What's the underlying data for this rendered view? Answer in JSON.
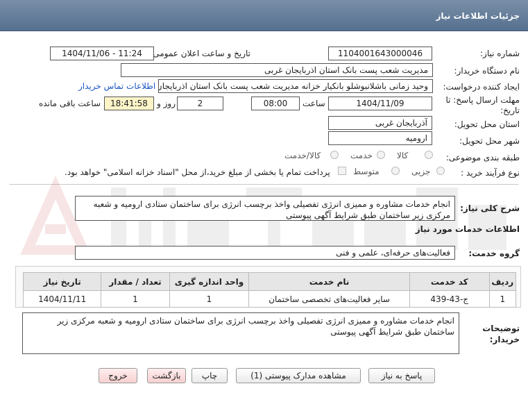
{
  "header": {
    "title": "جزئیات اطلاعات نیاز"
  },
  "form": {
    "need_number_label": "شماره نیاز:",
    "need_number": "1104001643000046",
    "announce_label": "تاریخ و ساعت اعلان عمومی:",
    "announce_value": "1404/11/06 - 11:24",
    "buyer_org_label": "نام دستگاه خریدار:",
    "buyer_org": "مدیریت شعب پست بانک استان اذربایجان غربی",
    "creator_label": "ایجاد کننده درخواست:",
    "creator": "وحید زمانی باشلانبوشلو بانکیار خزانه مدیریت شعب پست بانک استان اذربایجان",
    "contact_link": "اطلاعات تماس خریدار",
    "deadline_label_1": "مهلت ارسال پاسخ: تا",
    "deadline_label_2": "تاریخ:",
    "deadline_date": "1404/11/09",
    "time_label": "ساعت",
    "deadline_time": "08:00",
    "days_value": "2",
    "days_label": "روز و",
    "remaining_time": "18:41:58",
    "remaining_label": "ساعت باقی مانده",
    "province_label": "استان محل تحویل:",
    "province": "آذربایجان غربی",
    "city_label": "شهر محل تحویل:",
    "city": "ارومیه",
    "category_label": "طبقه بندی موضوعی:",
    "category_options": [
      "کالا",
      "خدمت",
      "کالا/خدمت"
    ],
    "category_selected": "خدمت",
    "process_label": "نوع فرآیند خرید :",
    "process_options": [
      "جزیی",
      "متوسط"
    ],
    "payment_note": "پرداخت تمام یا بخشی از مبلغ خرید،از محل \"اسناد خزانه اسلامی\" خواهد بود."
  },
  "description": {
    "label": "شرح کلی نیاز:",
    "text": "انجام خدمات مشاوره و ممیزی انرژی تفصیلی واخذ برچسب انرژی برای ساختمان ستادی ارومیه و شعبه مرکزی زیر ساختمان طبق شرایط آگهی پیوستی"
  },
  "services": {
    "section_title": "اطلاعات خدمات مورد نیاز",
    "group_label": "گروه خدمت:",
    "group_value": "فعالیت‌های حرفه‌ای، علمی و فنی",
    "columns": [
      "ردیف",
      "کد خدمت",
      "نام خدمت",
      "واحد اندازه گیری",
      "تعداد / مقدار",
      "تاریخ نیاز"
    ],
    "rows": [
      {
        "row": "1",
        "code": "ج-43-439",
        "name": "سایر فعالیت‌های تخصصی ساختمان",
        "unit": "1",
        "qty": "1",
        "date": "1404/11/11"
      }
    ]
  },
  "buyer_notes": {
    "label_1": "توضیحات",
    "label_2": "خریدار:",
    "text": "انجام خدمات مشاوره و ممیزی انرژی تفصیلی واخذ برچسب انرژی برای ساختمان ستادی ارومیه و شعبه مرکزی زیر ساختمان طبق شرایط آگهی پیوستی"
  },
  "buttons": {
    "reply": "پاسخ به نیاز",
    "attachments": "مشاهده مدارک پیوستی (1)",
    "print": "چاپ",
    "back": "بازگشت",
    "exit": "خروج"
  }
}
